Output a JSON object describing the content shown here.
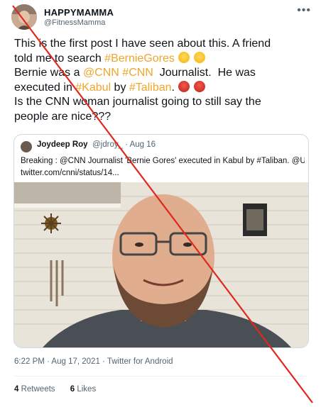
{
  "author": {
    "display_name": "HAPPYMAMMA",
    "handle": "@FitnessMamma"
  },
  "menu_icon": "more-horizontal-icon",
  "post": {
    "line1": "This is the first post I have seen about this. A friend",
    "line2_prefix": "told me to search ",
    "line2_hashtag": "#BernieGores",
    "line2_emojis": [
      "flushed-face-emoji",
      "surprised-face-emoji"
    ],
    "line3_prefix": "Bernie was a ",
    "line3_mention": "@CNN",
    "line3_hashtag": "#CNN",
    "line3_suffix": "  Journalist.  He was",
    "line4_prefix": "executed in ",
    "line4_hashtag1": "#Kabul",
    "line4_mid": " by ",
    "line4_hashtag2": "#Taliban",
    "line4_suffix": ".",
    "line4_emojis": [
      "angry-face-emoji",
      "angry-face-emoji"
    ],
    "line5": "Is the CNN woman journalist going to still say the",
    "line6": "people are nice???"
  },
  "quoted_tweet": {
    "name": "Joydeep Roy",
    "handle_date": "@jdroy_ · Aug 16",
    "text_line1": "Breaking : @CNN Journalist 'Bernie Gores' executed in Kabul by #Taliban. @UN",
    "text_line2": "twitter.com/cnni/status/14..."
  },
  "meta": {
    "timestamp": "6:22 PM · Aug 17, 2021 · Twitter for Android"
  },
  "stats": {
    "retweets_count": "4",
    "retweets_label": " Retweets",
    "likes_count": "6",
    "likes_label": " Likes"
  },
  "colors": {
    "hashtag": "#f0a52b",
    "strike_line": "#e0281e",
    "secondary_text": "#536471"
  }
}
